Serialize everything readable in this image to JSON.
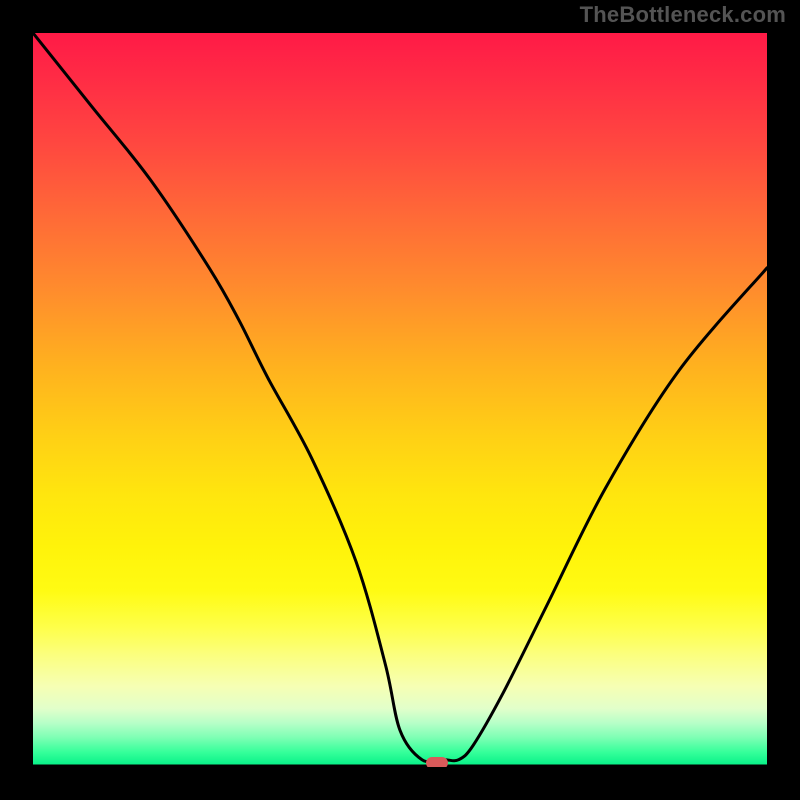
{
  "watermark": "TheBottleneck.com",
  "colors": {
    "page_bg": "#000000",
    "curve": "#000000",
    "marker": "#d85a5a",
    "gradient_top": "#ff1a46",
    "gradient_bottom": "#00ef85"
  },
  "chart_data": {
    "type": "line",
    "title": "",
    "xlabel": "",
    "ylabel": "",
    "xlim": [
      0,
      100
    ],
    "ylim": [
      0,
      100
    ],
    "grid": false,
    "series": [
      {
        "name": "bottleneck-curve",
        "x": [
          0,
          8,
          16,
          24,
          28,
          32,
          38,
          44,
          48,
          50,
          53,
          56,
          58,
          60,
          64,
          70,
          78,
          88,
          100
        ],
        "values": [
          100,
          90,
          80,
          68,
          61,
          53,
          42,
          28,
          14,
          5,
          1,
          1,
          1,
          3,
          10,
          22,
          38,
          54,
          68
        ]
      }
    ],
    "baseline_y": 0,
    "marker": {
      "x": 55,
      "y": 0
    }
  }
}
